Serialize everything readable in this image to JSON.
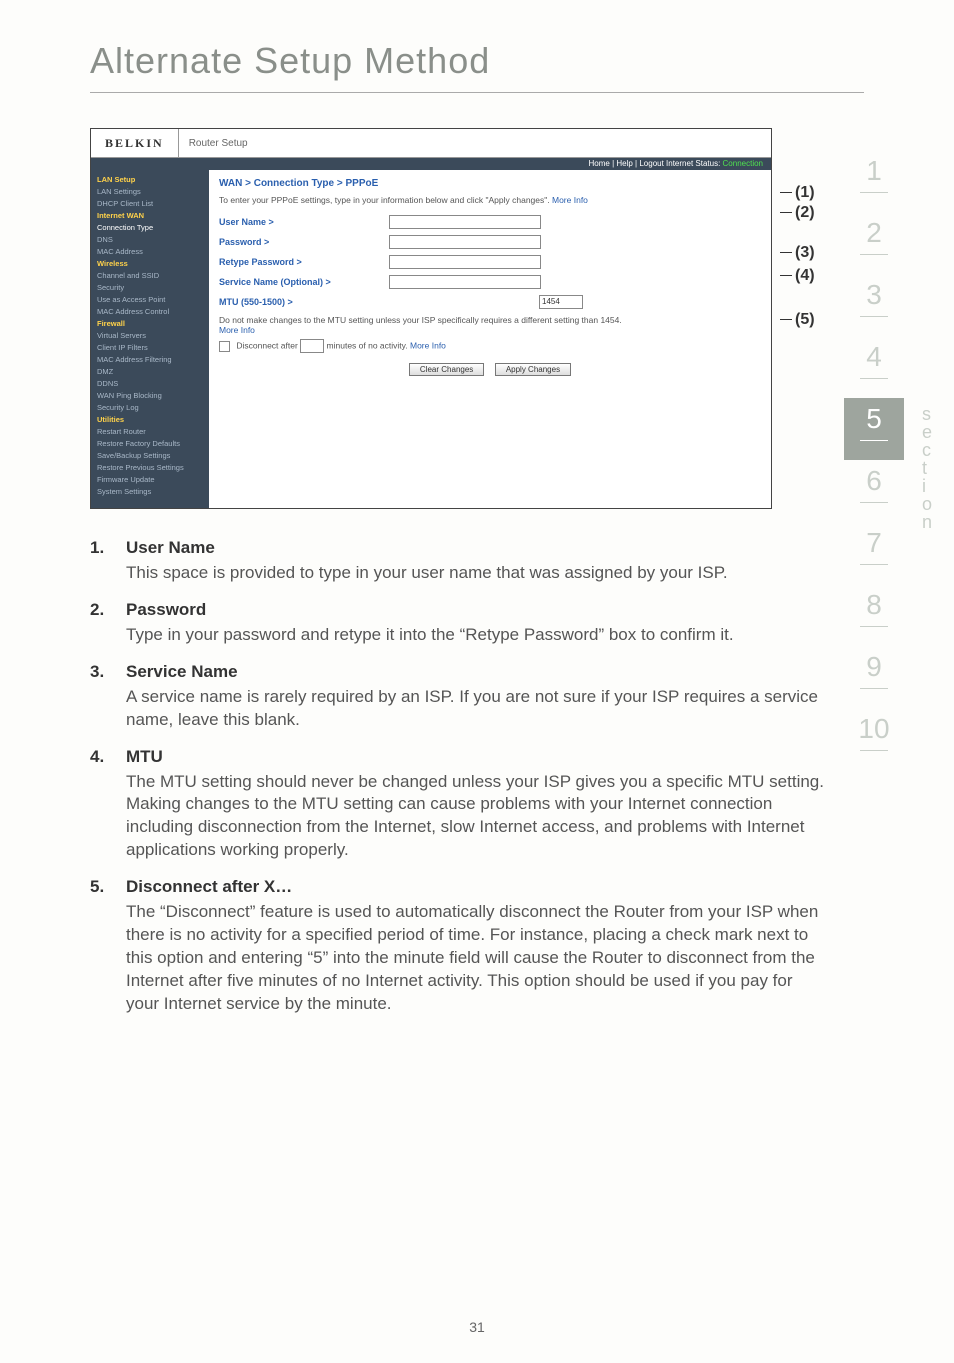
{
  "page": {
    "title": "Alternate Setup Method",
    "number": "31"
  },
  "section_index": [
    "1",
    "2",
    "3",
    "4",
    "5",
    "6",
    "7",
    "8",
    "9",
    "10"
  ],
  "section_index_active": 4,
  "section_label": "section",
  "screenshot": {
    "logo": "BELKIN",
    "router_setup": "Router Setup",
    "status_bar_prefix": "Home | Help | Logout   Internet Status: ",
    "status_bar_conn": "Connection",
    "sidebar": [
      {
        "t": "LAN Setup",
        "c": "hdr"
      },
      {
        "t": "LAN Settings"
      },
      {
        "t": "DHCP Client List"
      },
      {
        "t": "Internet WAN",
        "c": "hdr"
      },
      {
        "t": "Connection Type",
        "c": "sel"
      },
      {
        "t": "DNS"
      },
      {
        "t": "MAC Address"
      },
      {
        "t": "Wireless",
        "c": "hdr"
      },
      {
        "t": "Channel and SSID"
      },
      {
        "t": "Security"
      },
      {
        "t": "Use as Access Point"
      },
      {
        "t": "MAC Address Control"
      },
      {
        "t": "Firewall",
        "c": "hdr"
      },
      {
        "t": "Virtual Servers"
      },
      {
        "t": "Client IP Filters"
      },
      {
        "t": "MAC Address Filtering"
      },
      {
        "t": "DMZ"
      },
      {
        "t": "DDNS"
      },
      {
        "t": "WAN Ping Blocking"
      },
      {
        "t": "Security Log"
      },
      {
        "t": "Utilities",
        "c": "hdr"
      },
      {
        "t": "Restart Router"
      },
      {
        "t": "Restore Factory Defaults"
      },
      {
        "t": "Save/Backup Settings"
      },
      {
        "t": "Restore Previous Settings"
      },
      {
        "t": "Firmware Update"
      },
      {
        "t": "System Settings"
      }
    ],
    "breadcrumb": "WAN > Connection Type > PPPoE",
    "hint_text": "To enter your PPPoE settings, type in your information below and click \"Apply changes\". ",
    "more_info": "More Info",
    "rows": {
      "user_name": "User Name >",
      "password": "Password >",
      "retype": "Retype Password >",
      "service": "Service Name (Optional) >",
      "mtu": "MTU (550-1500) >",
      "mtu_value": "1454"
    },
    "mtu_note": "Do not make changes to the MTU setting unless your ISP specifically requires a different setting than 1454.",
    "disc_prefix": "Disconnect after ",
    "disc_suffix": " minutes of no activity. ",
    "btn_clear": "Clear Changes",
    "btn_apply": "Apply Changes",
    "callouts": [
      "(1)",
      "(2)",
      "(3)",
      "(4)",
      "(5)"
    ]
  },
  "items": [
    {
      "num": "1.",
      "heading": "User Name",
      "body": "This space is provided to type in your user name that was assigned by your ISP."
    },
    {
      "num": "2.",
      "heading": "Password",
      "body": "Type in your password and retype it into the “Retype Password” box to confirm it."
    },
    {
      "num": "3.",
      "heading": "Service Name",
      "body": "A service name is rarely required by an ISP. If you are not sure if your ISP requires a service name, leave this blank."
    },
    {
      "num": "4.",
      "heading": "MTU",
      "body": "The MTU setting should never be changed unless your ISP gives you a specific MTU setting. Making changes to the MTU setting can cause problems with your Internet connection including disconnection from the Internet, slow Internet access, and problems with Internet applications working properly."
    },
    {
      "num": "5.",
      "heading": "Disconnect after X…",
      "body": "The “Disconnect” feature is used to automatically disconnect the Router from your ISP when there is no activity for a specified period of time. For instance, placing a check mark next to this option and entering “5” into the minute field will cause the Router to disconnect from the Internet after five minutes of no Internet activity. This option should be used if you pay for your Internet service by the minute."
    }
  ]
}
